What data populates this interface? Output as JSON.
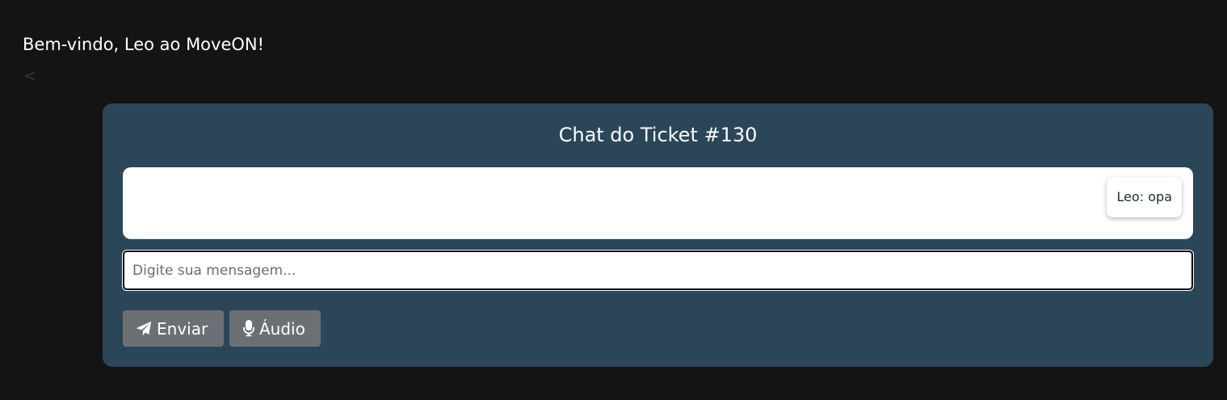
{
  "header": {
    "welcome_text": "Bem-vindo, Leo ao MoveON!",
    "back_label": "<"
  },
  "chat": {
    "title": "Chat do Ticket #130",
    "messages": [
      {
        "text": "Leo: opa"
      }
    ],
    "input": {
      "value": "",
      "placeholder": "Digite sua mensagem..."
    },
    "send_label": "Enviar",
    "audio_label": "Áudio"
  },
  "icons": {
    "send": "paper-plane-icon",
    "audio": "microphone-icon"
  },
  "colors": {
    "background": "#141414",
    "card": "#2b4659",
    "button": "#6c7075"
  }
}
